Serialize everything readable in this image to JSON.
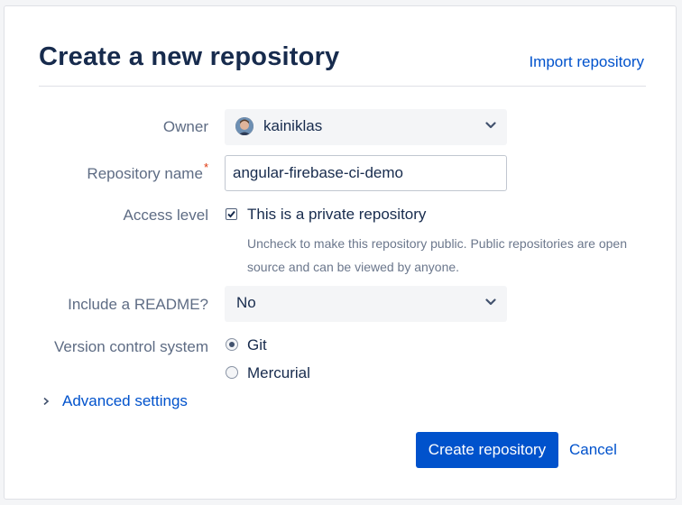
{
  "header": {
    "title": "Create a new repository",
    "import_link": "Import repository"
  },
  "form": {
    "owner": {
      "label": "Owner",
      "value": "kainiklas"
    },
    "repo_name": {
      "label": "Repository name",
      "required_mark": "*",
      "value": "angular-firebase-ci-demo"
    },
    "access": {
      "label": "Access level",
      "checkbox_label": "This is a private repository",
      "checked": true,
      "help": "Uncheck to make this repository public. Public repositories are open source and can be viewed by anyone."
    },
    "readme": {
      "label": "Include a README?",
      "value": "No"
    },
    "vcs": {
      "label": "Version control system",
      "options": [
        {
          "label": "Git",
          "selected": true
        },
        {
          "label": "Mercurial",
          "selected": false
        }
      ]
    },
    "advanced": {
      "label": "Advanced settings",
      "icon": "chevron-right-icon"
    }
  },
  "actions": {
    "create_label": "Create repository",
    "cancel_label": "Cancel"
  },
  "colors": {
    "accent": "#0052cc",
    "title": "#172b4d",
    "label": "#5e6c84",
    "required": "#de350b"
  }
}
